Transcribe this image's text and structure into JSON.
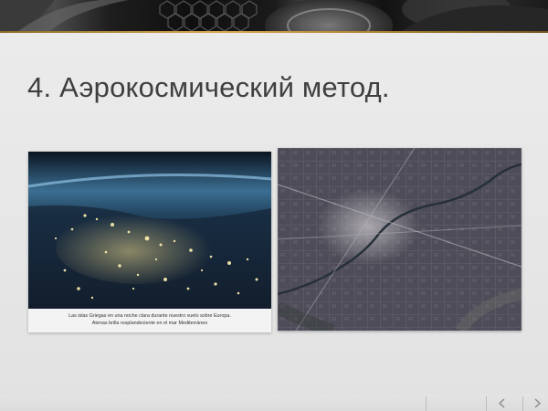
{
  "slide": {
    "title": "4. Аэрокосмический метод."
  },
  "photo_left": {
    "caption_line1": "Las islas Griegas en una noche clara durante nuestro vuelo sobre Europa.",
    "caption_line2": "Atenas brilla resplandeciente en el mar Mediterráneo"
  },
  "icons": {
    "nav_prev": "prev-slide-icon",
    "nav_next": "next-slide-icon"
  },
  "colors": {
    "accent_gold": "#d6a84e",
    "title_text": "#3f3f3f",
    "background": "#e7e7e7"
  }
}
